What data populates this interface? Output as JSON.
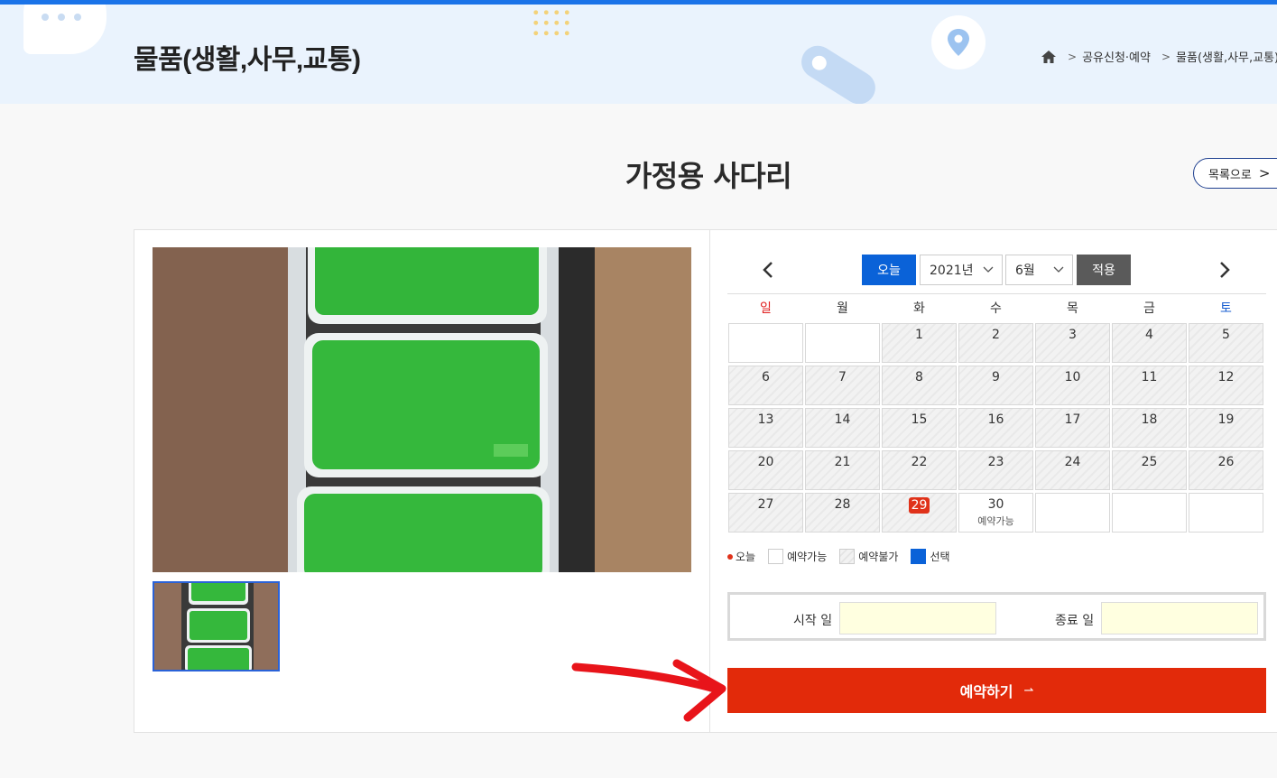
{
  "header": {
    "title": "물품(생활,사무,교통)",
    "breadcrumb": [
      "공유신청·예약",
      "물품(생활,사무,교통)"
    ]
  },
  "item": {
    "title": "가정용 사다리",
    "list_button": "목록으로"
  },
  "calendar": {
    "today_button": "오늘",
    "year": "2021년",
    "month": "6월",
    "apply_button": "적용",
    "weekdays": [
      "일",
      "월",
      "화",
      "수",
      "목",
      "금",
      "토"
    ],
    "today": "29",
    "available_label": "예약가능"
  },
  "legend": {
    "today": "오늘",
    "available": "예약가능",
    "unavailable": "예약불가",
    "selected": "선택"
  },
  "dates": {
    "start_label": "시작 일",
    "end_label": "종료 일",
    "start_value": "",
    "end_value": ""
  },
  "reserve_button": "예약하기",
  "colors": {
    "primary_blue": "#0a62d8",
    "reserve_red": "#e22a0a",
    "hero_bg": "#eaf3fd"
  }
}
